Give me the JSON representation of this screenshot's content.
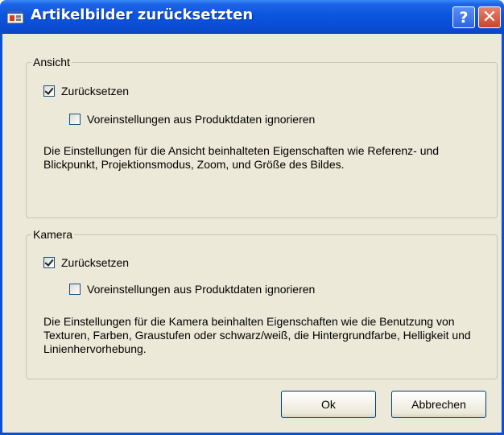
{
  "window": {
    "title": "Artikelbilder zurücksetzten",
    "icon": "app-window-icon",
    "help_label": "?",
    "close_label": "✕"
  },
  "groups": [
    {
      "legend": "Ansicht",
      "reset_label": "Zurücksetzen",
      "reset_checked": true,
      "ignore_label": "Voreinstellungen aus Produktdaten ignorieren",
      "ignore_checked": false,
      "description": "Die Einstellungen für die Ansicht beinhalteten Eigenschaften wie Referenz- und Blickpunkt, Projektionsmodus, Zoom, und Größe des Bildes."
    },
    {
      "legend": "Kamera",
      "reset_label": "Zurücksetzen",
      "reset_checked": true,
      "ignore_label": "Voreinstellungen aus Produktdaten ignorieren",
      "ignore_checked": false,
      "description": "Die Einstellungen für die Kamera beinhalten Eigenschaften wie die Benutzung von Texturen, Farben, Graustufen oder schwarz/weiß, die Hintergrundfarbe, Helligkeit und Linienhervorhebung."
    }
  ],
  "buttons": {
    "ok_label": "Ok",
    "cancel_label": "Abbrechen"
  },
  "colors": {
    "titlebar": "#0a55e0",
    "dialog_background": "#ece9d8",
    "close_button": "#c8452a"
  }
}
